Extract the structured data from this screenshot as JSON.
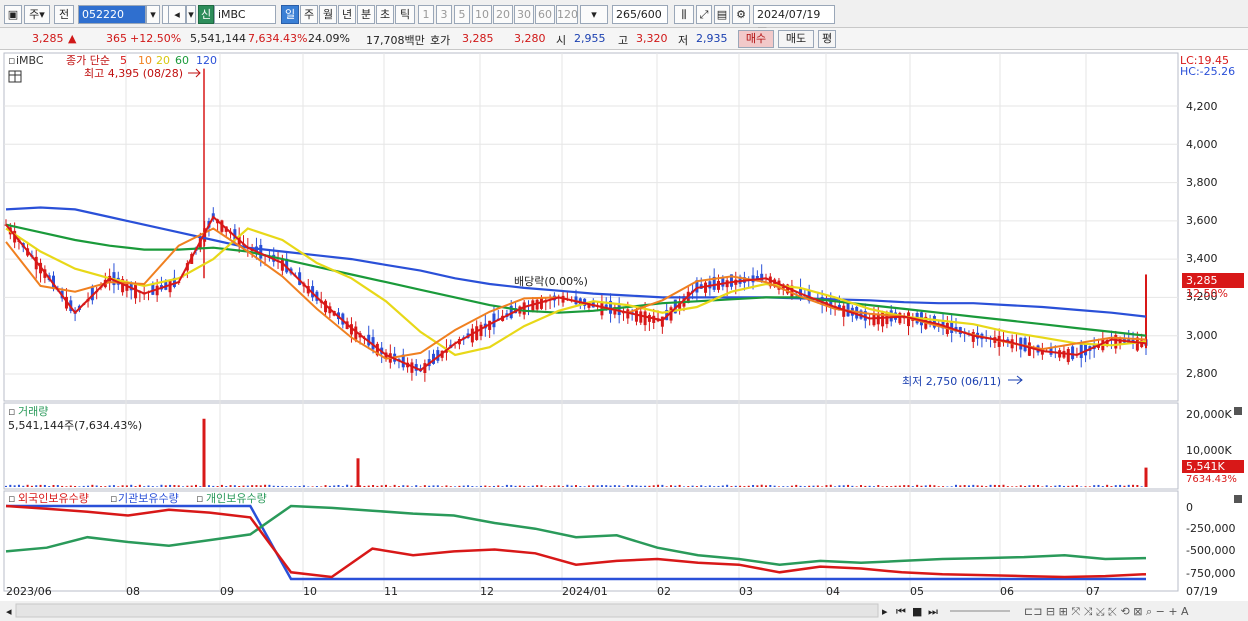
{
  "toolbar": {
    "period_type": "주",
    "prev_label": "전",
    "stock_code": "052220",
    "stock_name_badge": "신",
    "stock_name": "iMBC",
    "interval_tabs": [
      "일",
      "주",
      "월",
      "년",
      "분",
      "초",
      "틱"
    ],
    "interval_selected": "일",
    "number_buttons": [
      "1",
      "3",
      "5",
      "10",
      "20",
      "30",
      "60",
      "120"
    ],
    "count_current": "265",
    "count_total": "/600",
    "date": "2024/07/19"
  },
  "quote": {
    "price": "3,285",
    "arrow": "▲",
    "change": "365",
    "change_pct": "+12.50%",
    "volume": "5,541,144",
    "volume_ratio": "7,634.43%",
    "turnover": "24.09%",
    "amount": "17,708백만",
    "bid_label": "호가",
    "bid_price": "3,285",
    "ask_price": "3,280",
    "open_label": "시",
    "open": "2,955",
    "high_label": "고",
    "high": "3,320",
    "low_label": "저",
    "low": "2,935",
    "buy_button": "매수",
    "sell_button": "매도",
    "avg_button": "평"
  },
  "price_panel": {
    "stock_label": "iMBC",
    "ma_legend": "종가 단순",
    "ma_periods": [
      "5",
      "10",
      "20",
      "60",
      "120"
    ],
    "ma_colors": [
      "#d81818",
      "#f08020",
      "#e8d818",
      "#1a9a3a",
      "#2a50d8"
    ],
    "lc_label": "LC:19.45",
    "hc_label": "HC:-25.26",
    "high_annotation": "최고 4,395 (08/28)",
    "low_annotation": "최저 2,750 (06/11)",
    "dividend_annotation": "배당락(0.00%)",
    "y_ticks": [
      "4,200",
      "4,000",
      "3,800",
      "3,600",
      "3,400",
      "3,200",
      "3,000",
      "2,800"
    ],
    "current_price_tag": "3,285",
    "current_pct_tag": "12.50%"
  },
  "volume_panel": {
    "title": "거래량",
    "summary": "5,541,144주(7,634.43%)",
    "y_ticks": [
      "20,000K",
      "10,000K"
    ],
    "current_tag": "5,541K",
    "current_pct_tag": "7634.43%"
  },
  "holdings_panel": {
    "legend": [
      "외국인보유수량",
      "기관보유수량",
      "개인보유수량"
    ],
    "colors": [
      "#d81818",
      "#2a50d8",
      "#2a9a5a"
    ],
    "y_ticks": [
      "0",
      "-250,000",
      "-500,000",
      "-750,000"
    ]
  },
  "x_axis": {
    "labels": [
      "2023/06",
      "08",
      "09",
      "10",
      "11",
      "12",
      "2024/01",
      "02",
      "03",
      "04",
      "05",
      "06",
      "07",
      "07/19"
    ]
  },
  "chart_data": {
    "type": "line",
    "title": "iMBC 종가 단순",
    "price_range": [
      2700,
      4400
    ],
    "high": {
      "value": 4395,
      "date": "08/28"
    },
    "low": {
      "value": 2750,
      "date": "06/11"
    },
    "ma120": [
      3660,
      3670,
      3660,
      3620,
      3580,
      3540,
      3500,
      3460,
      3440,
      3420,
      3400,
      3370,
      3340,
      3300,
      3270,
      3250,
      3235,
      3220,
      3210,
      3200,
      3200,
      3200,
      3200,
      3195,
      3190,
      3185,
      3175,
      3170,
      3170,
      3160,
      3150,
      3135,
      3120,
      3100
    ],
    "ma60": [
      3580,
      3540,
      3500,
      3470,
      3450,
      3450,
      3460,
      3440,
      3400,
      3360,
      3320,
      3280,
      3240,
      3200,
      3160,
      3130,
      3120,
      3130,
      3150,
      3170,
      3180,
      3190,
      3200,
      3200,
      3180,
      3160,
      3140,
      3120,
      3100,
      3080,
      3060,
      3040,
      3020,
      3000
    ],
    "ma20": [
      3560,
      3440,
      3350,
      3300,
      3260,
      3300,
      3400,
      3560,
      3500,
      3380,
      3300,
      3180,
      3020,
      2900,
      2940,
      3050,
      3130,
      3180,
      3160,
      3120,
      3150,
      3230,
      3270,
      3250,
      3200,
      3140,
      3100,
      3080,
      3060,
      3020,
      2990,
      2960,
      2950,
      2970
    ],
    "ma5": [
      3580,
      3360,
      3120,
      3300,
      3220,
      3280,
      3620,
      3460,
      3380,
      3200,
      3040,
      2900,
      2820,
      2960,
      3060,
      3150,
      3200,
      3160,
      3120,
      3080,
      3250,
      3280,
      3300,
      3220,
      3150,
      3090,
      3100,
      3060,
      3000,
      2970,
      2920,
      2900,
      2980,
      2960
    ],
    "volume_spikes": [
      {
        "date": "08/28",
        "value": 19500
      },
      {
        "date": "10/30",
        "value": 8200
      },
      {
        "date": "07/19",
        "value": 5541
      }
    ],
    "holdings": {
      "foreign": [
        0,
        -30000,
        -60000,
        -100000,
        -40000,
        -70000,
        -120000,
        -700000,
        -750000,
        -450000,
        -520000,
        -480000,
        -460000,
        -500000,
        -620000,
        -580000,
        -560000,
        -600000,
        -620000,
        -700000,
        -640000,
        -660000,
        -700000,
        -720000,
        -730000,
        -740000,
        -750000,
        -740000,
        -720000
      ],
      "institution": [
        0,
        0,
        0,
        0,
        0,
        0,
        0,
        -800000,
        -800000,
        -800000,
        -800000,
        -800000,
        -800000,
        -800000,
        -800000,
        -800000,
        -800000,
        -800000,
        -800000,
        -800000,
        -800000,
        -800000,
        -800000,
        -800000,
        -800000,
        -800000,
        -800000,
        -800000,
        -800000
      ],
      "individual": [
        -480000,
        -440000,
        -330000,
        -380000,
        -420000,
        -360000,
        -300000,
        0,
        -20000,
        -50000,
        -80000,
        -100000,
        -180000,
        -240000,
        -330000,
        -310000,
        -440000,
        -520000,
        -560000,
        -620000,
        -580000,
        -600000,
        -580000,
        -560000,
        -550000,
        -540000,
        -520000,
        -560000,
        -550000
      ]
    }
  }
}
